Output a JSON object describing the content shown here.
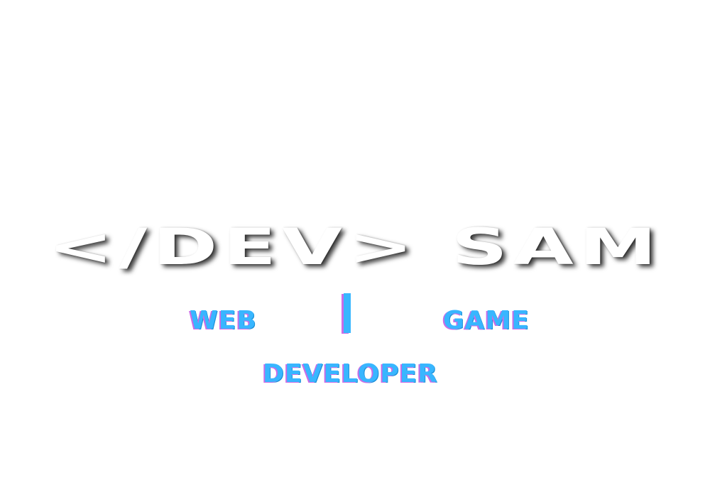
{
  "logo": {
    "text": "</DEV> SAM"
  },
  "tagline": {
    "left": "WEB",
    "right": "GAME",
    "bottom": "DEVELOPER"
  },
  "colors": {
    "background": "#ffffff",
    "logo_text": "#ffffff",
    "accent_blue": "#38b6ff",
    "accent_purple": "#cb6ce6"
  }
}
